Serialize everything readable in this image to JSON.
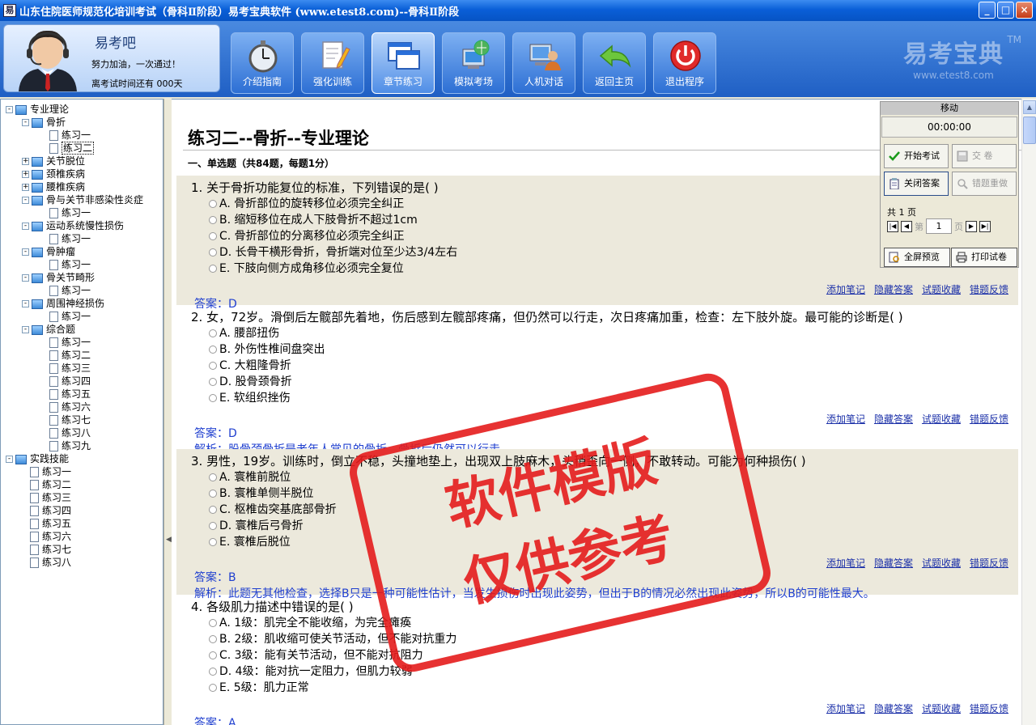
{
  "window": {
    "title": "山东住院医师规范化培训考试（骨科Ⅱ阶段）易考宝典软件  (www.etest8.com)--骨科Ⅱ阶段",
    "min": "_",
    "max": "□",
    "close": "×"
  },
  "user": {
    "name": "易考吧",
    "motto": "努力加油，一次通过！",
    "days": "离考试时间还有 000天"
  },
  "nav": [
    {
      "label": "介绍指南",
      "icon": "stopwatch-icon"
    },
    {
      "label": "强化训练",
      "icon": "notepad-pencil-icon"
    },
    {
      "label": "章节练习",
      "icon": "windows-icon"
    },
    {
      "label": "模拟考场",
      "icon": "globe-computer-icon"
    },
    {
      "label": "人机对话",
      "icon": "user-computer-icon"
    },
    {
      "label": "返回主页",
      "icon": "return-arrow-icon"
    },
    {
      "label": "退出程序",
      "icon": "power-icon"
    }
  ],
  "brand": {
    "name": "易考宝典",
    "url": "www.etest8.com",
    "tm": "TM"
  },
  "tree": [
    {
      "label": "专业理论",
      "lvl": 0,
      "type": "folder",
      "exp": "-"
    },
    {
      "label": "骨折",
      "lvl": 1,
      "type": "folder",
      "exp": "-"
    },
    {
      "label": "练习一",
      "lvl": 2,
      "type": "doc"
    },
    {
      "label": "练习二",
      "lvl": 2,
      "type": "doc",
      "sel": true
    },
    {
      "label": "关节脱位",
      "lvl": 1,
      "type": "folder",
      "exp": "+"
    },
    {
      "label": "颈椎疾病",
      "lvl": 1,
      "type": "folder",
      "exp": "+"
    },
    {
      "label": "腰椎疾病",
      "lvl": 1,
      "type": "folder",
      "exp": "+"
    },
    {
      "label": "骨与关节非感染性炎症",
      "lvl": 1,
      "type": "folder",
      "exp": "-"
    },
    {
      "label": "练习一",
      "lvl": 2,
      "type": "doc"
    },
    {
      "label": "运动系统慢性损伤",
      "lvl": 1,
      "type": "folder",
      "exp": "-"
    },
    {
      "label": "练习一",
      "lvl": 2,
      "type": "doc"
    },
    {
      "label": "骨肿瘤",
      "lvl": 1,
      "type": "folder",
      "exp": "-"
    },
    {
      "label": "练习一",
      "lvl": 2,
      "type": "doc"
    },
    {
      "label": "骨关节畸形",
      "lvl": 1,
      "type": "folder",
      "exp": "-"
    },
    {
      "label": "练习一",
      "lvl": 2,
      "type": "doc"
    },
    {
      "label": "周围神经损伤",
      "lvl": 1,
      "type": "folder",
      "exp": "-"
    },
    {
      "label": "练习一",
      "lvl": 2,
      "type": "doc"
    },
    {
      "label": "综合题",
      "lvl": 1,
      "type": "folder",
      "exp": "-"
    },
    {
      "label": "练习一",
      "lvl": 2,
      "type": "doc"
    },
    {
      "label": "练习二",
      "lvl": 2,
      "type": "doc"
    },
    {
      "label": "练习三",
      "lvl": 2,
      "type": "doc"
    },
    {
      "label": "练习四",
      "lvl": 2,
      "type": "doc"
    },
    {
      "label": "练习五",
      "lvl": 2,
      "type": "doc"
    },
    {
      "label": "练习六",
      "lvl": 2,
      "type": "doc"
    },
    {
      "label": "练习七",
      "lvl": 2,
      "type": "doc"
    },
    {
      "label": "练习八",
      "lvl": 2,
      "type": "doc"
    },
    {
      "label": "练习九",
      "lvl": 2,
      "type": "doc"
    },
    {
      "label": "实践技能",
      "lvl": 0,
      "type": "folder",
      "exp": "-"
    },
    {
      "label": "练习一",
      "lvl": 1,
      "type": "doc"
    },
    {
      "label": "练习二",
      "lvl": 1,
      "type": "doc"
    },
    {
      "label": "练习三",
      "lvl": 1,
      "type": "doc"
    },
    {
      "label": "练习四",
      "lvl": 1,
      "type": "doc"
    },
    {
      "label": "练习五",
      "lvl": 1,
      "type": "doc"
    },
    {
      "label": "练习六",
      "lvl": 1,
      "type": "doc"
    },
    {
      "label": "练习七",
      "lvl": 1,
      "type": "doc"
    },
    {
      "label": "练习八",
      "lvl": 1,
      "type": "doc"
    }
  ],
  "page": {
    "title": "练习二--骨折--专业理论",
    "section": "一、单选题（共84题，每题1分）"
  },
  "links": {
    "note": "添加笔记",
    "hide": "隐藏答案",
    "fav": "试题收藏",
    "report": "错题反馈"
  },
  "questions": [
    {
      "q": "1. 关于骨折功能复位的标准，下列错误的是(  )",
      "opts": [
        "A. 骨折部位的旋转移位必须完全纠正",
        "B. 缩短移位在成人下肢骨折不超过1cm",
        "C. 骨折部位的分离移位必须完全纠正",
        "D. 长骨干横形骨折，骨折端对位至少达3/4左右",
        "E. 下肢向侧方成角移位必须完全复位"
      ],
      "ans": "答案：D",
      "expl": ""
    },
    {
      "q": "2. 女，72岁。滑倒后左髋部先着地，伤后感到左髋部疼痛，但仍然可以行走，次日疼痛加重，检查：左下肢外旋。最可能的诊断是(  )",
      "opts": [
        "A. 腰部扭伤",
        "B. 外伤性椎间盘突出",
        "C. 大粗隆骨折",
        "D. 股骨颈骨折",
        "E. 软组织挫伤"
      ],
      "ans": "答案：D",
      "expl": "解析：股骨颈骨折是老年人常见的骨折，骨折后仍然可以行走。"
    },
    {
      "q": "3. 男性，19岁。训练时，倒立不稳，头撞地垫上，出现双上肢麻木，头稍歪向一侧，不敢转动。可能为何种损伤(  )",
      "opts": [
        "A. 寰椎前脱位",
        "B. 寰椎单侧半脱位",
        "C. 枢椎齿突基底部骨折",
        "D. 寰椎后弓骨折",
        "E. 寰椎后脱位"
      ],
      "ans": "答案：B",
      "expl": "解析：此题无其他检查，选择B只是一种可能性估计，当发生损伤时出现此姿势，但出于B的情况必然出现此姿势，所以B的可能性最大。"
    },
    {
      "q": "4. 各级肌力描述中错误的是(  )",
      "opts": [
        "A. 1级：肌完全不能收缩，为完全瘫痪",
        "B. 2级：肌收缩可使关节活动，但不能对抗重力",
        "C. 3级：能有关节活动，但不能对抗阻力",
        "D. 4级：能对抗一定阻力，但肌力较弱",
        "E. 5级：肌力正常"
      ],
      "ans": "答案：A",
      "expl": ""
    }
  ],
  "control": {
    "header": "移动",
    "timer": "00:00:00",
    "start": "开始考试",
    "submit": "交    卷",
    "close_ans": "关闭答案",
    "redo": "错题重做",
    "total": "共 1 页",
    "di": "第",
    "page": "1",
    "ye": "页",
    "full": "全屏预览",
    "print": "打印试卷"
  },
  "stamp": {
    "line1": "软件模版",
    "line2": "仅供参考"
  }
}
